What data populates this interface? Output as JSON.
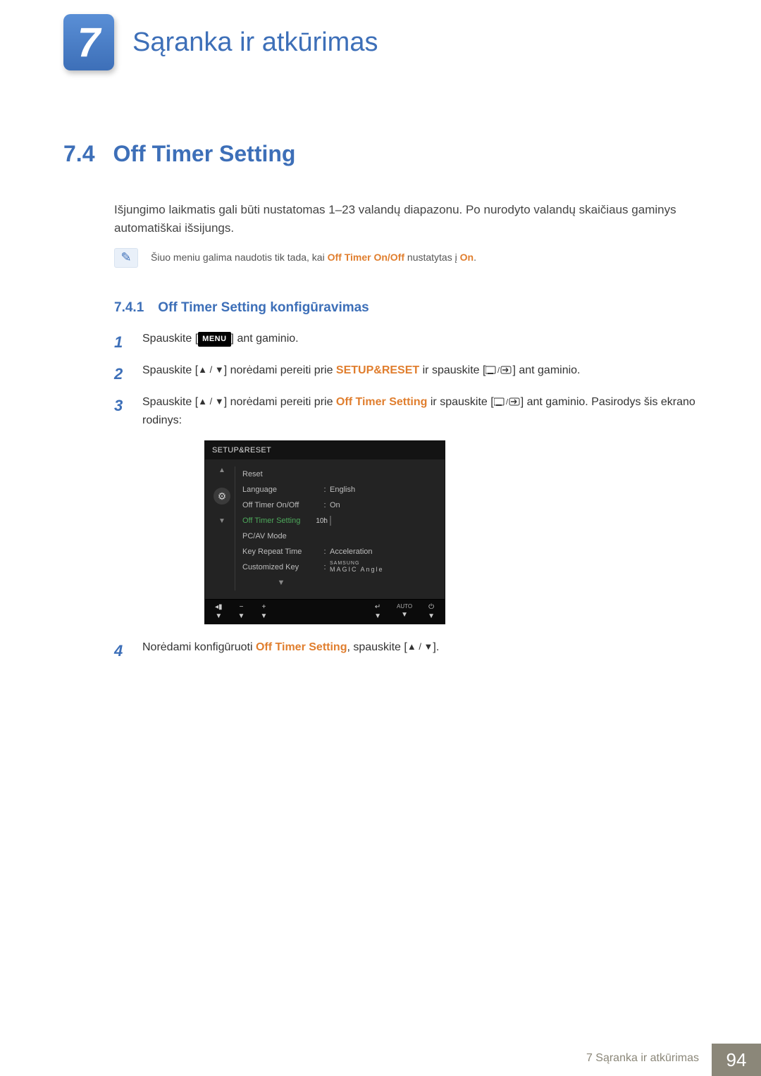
{
  "chapter": {
    "number": "7",
    "title": "Sąranka ir atkūrimas"
  },
  "section": {
    "number": "7.4",
    "title": "Off Timer Setting"
  },
  "intro": "Išjungimo laikmatis gali būti nustatomas 1–23 valandų diapazonu. Po nurodyto valandų skaičiaus gaminys automatiškai išsijungs.",
  "note": {
    "prefix": "Šiuo meniu galima naudotis tik tada, kai ",
    "hl1": "Off Timer On/Off",
    "mid": " nustatytas į ",
    "hl2": "On",
    "suffix": "."
  },
  "subsection": {
    "number": "7.4.1",
    "title": "Off Timer Setting konfigūravimas"
  },
  "steps": {
    "s1": {
      "a": "Spauskite [",
      "menu": "MENU",
      "b": "] ant gaminio."
    },
    "s2": {
      "a": "Spauskite [",
      "b": "] norėdami pereiti prie ",
      "hl": "SETUP&RESET",
      "c": " ir spauskite [",
      "d": "] ant gaminio."
    },
    "s3": {
      "a": "Spauskite [",
      "b": "] norėdami pereiti prie ",
      "hl": "Off Timer Setting",
      "c": " ir spauskite [",
      "d": "] ant gaminio. Pasirodys šis ekrano rodinys:"
    },
    "s4": {
      "a": "Norėdami konfigūruoti ",
      "hl": "Off Timer Setting",
      "b": ", spauskite [",
      "c": "]."
    }
  },
  "osd": {
    "title": "SETUP&RESET",
    "items": {
      "reset": "Reset",
      "language": "Language",
      "offtimer_onoff": "Off Timer On/Off",
      "offtimer_setting": "Off Timer Setting",
      "pcav": "PC/AV Mode",
      "keyrepeat": "Key Repeat Time",
      "customkey": "Customized Key"
    },
    "values": {
      "language": "English",
      "offtimer_onoff": "On",
      "slider_label": "10h",
      "keyrepeat": "Acceleration",
      "brand_small": "SAMSUNG",
      "brand_big": "MAGIC",
      "brand_suffix": "Angle"
    },
    "footer": {
      "auto": "AUTO"
    }
  },
  "footer": {
    "text": "7 Sąranka ir atkūrimas",
    "page": "94"
  }
}
